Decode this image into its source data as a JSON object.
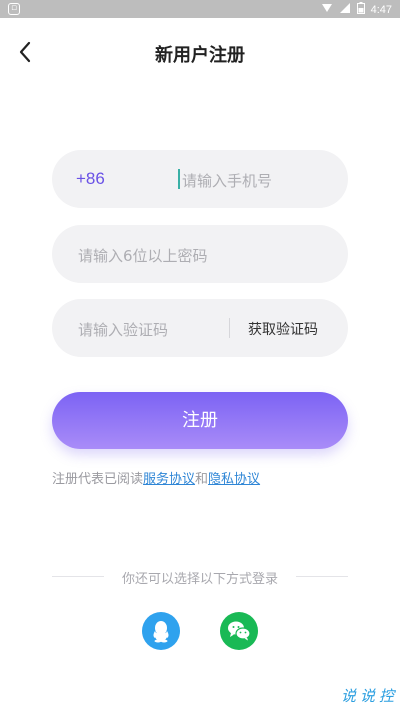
{
  "status_bar": {
    "time": "4:47"
  },
  "header": {
    "title": "新用户注册"
  },
  "form": {
    "phone_prefix": "+86",
    "phone_placeholder": "请输入手机号",
    "password_placeholder": "请输入6位以上密码",
    "code_placeholder": "请输入验证码",
    "get_code_label": "获取验证码",
    "register_label": "注册"
  },
  "agreement": {
    "prefix": "注册代表已阅读",
    "service_link": "服务协议",
    "conjunction": "和",
    "privacy_link": "隐私协议"
  },
  "other_login": {
    "label": "你还可以选择以下方式登录"
  },
  "social": {
    "qq_icon": "qq-icon",
    "wechat_icon": "wechat-icon"
  },
  "watermark": [
    "说",
    "说",
    "控"
  ],
  "colors": {
    "accent": "#7c63f4",
    "link": "#2f86d6",
    "qq": "#2fa2ee",
    "wechat": "#19b955"
  }
}
